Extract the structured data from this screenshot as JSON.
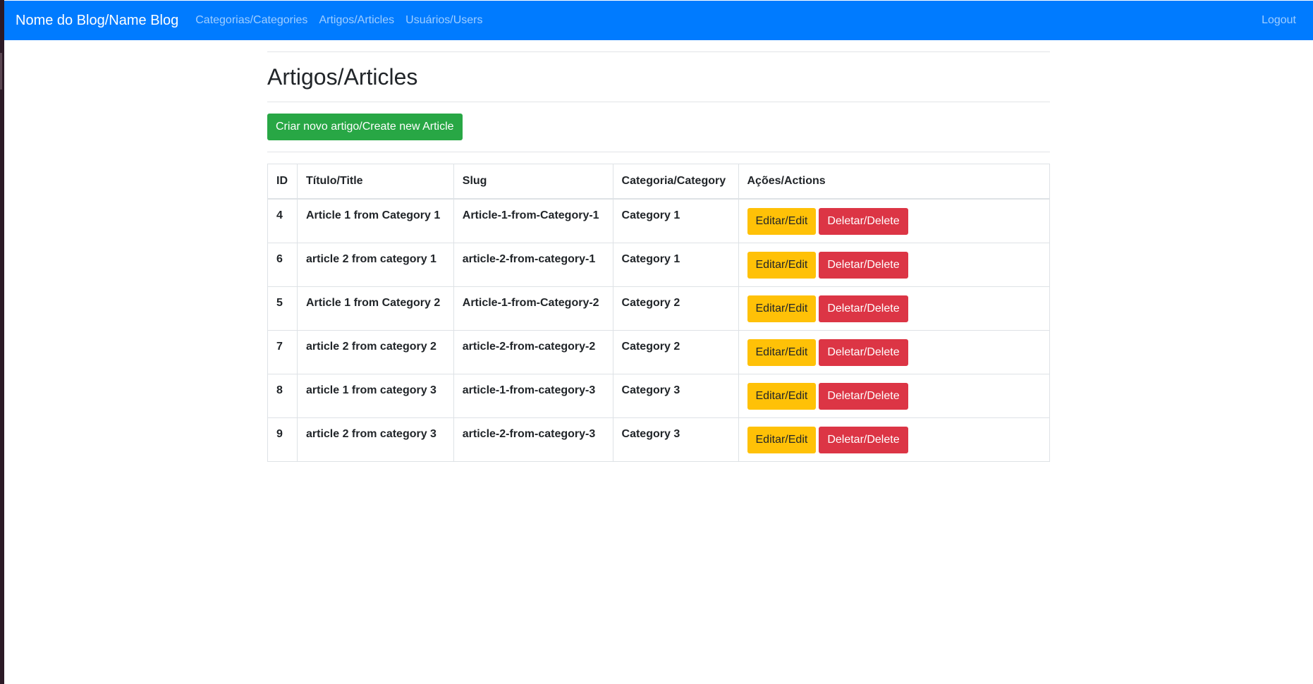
{
  "navbar": {
    "brand": "Nome do Blog/Name Blog",
    "links": [
      {
        "label": "Categorias/Categories"
      },
      {
        "label": "Artigos/Articles"
      },
      {
        "label": "Usuários/Users"
      }
    ],
    "logout": "Logout",
    "color": "#007bff"
  },
  "page": {
    "title": "Artigos/Articles",
    "create_button": "Criar novo artigo/Create new Article"
  },
  "table": {
    "headers": {
      "id": "ID",
      "title": "Título/Title",
      "slug": "Slug",
      "category": "Categoria/Category",
      "actions": "Ações/Actions"
    },
    "rows": [
      {
        "id": "4",
        "title": "Article 1 from Category 1",
        "slug": "Article-1-from-Category-1",
        "category": "Category 1",
        "edit": "Editar/Edit",
        "delete": "Deletar/Delete"
      },
      {
        "id": "6",
        "title": "article 2 from category 1",
        "slug": "article-2-from-category-1",
        "category": "Category 1",
        "edit": "Editar/Edit",
        "delete": "Deletar/Delete"
      },
      {
        "id": "5",
        "title": "Article 1 from Category 2",
        "slug": "Article-1-from-Category-2",
        "category": "Category 2",
        "edit": "Editar/Edit",
        "delete": "Deletar/Delete"
      },
      {
        "id": "7",
        "title": "article 2 from category 2",
        "slug": "article-2-from-category-2",
        "category": "Category 2",
        "edit": "Editar/Edit",
        "delete": "Deletar/Delete"
      },
      {
        "id": "8",
        "title": "article 1 from category 3",
        "slug": "article-1-from-category-3",
        "category": "Category 3",
        "edit": "Editar/Edit",
        "delete": "Deletar/Delete"
      },
      {
        "id": "9",
        "title": "article 2 from category 3",
        "slug": "article-2-from-category-3",
        "category": "Category 3",
        "edit": "Editar/Edit",
        "delete": "Deletar/Delete"
      }
    ]
  },
  "colors": {
    "success": "#28a745",
    "warning": "#ffc107",
    "danger": "#dc3545"
  }
}
